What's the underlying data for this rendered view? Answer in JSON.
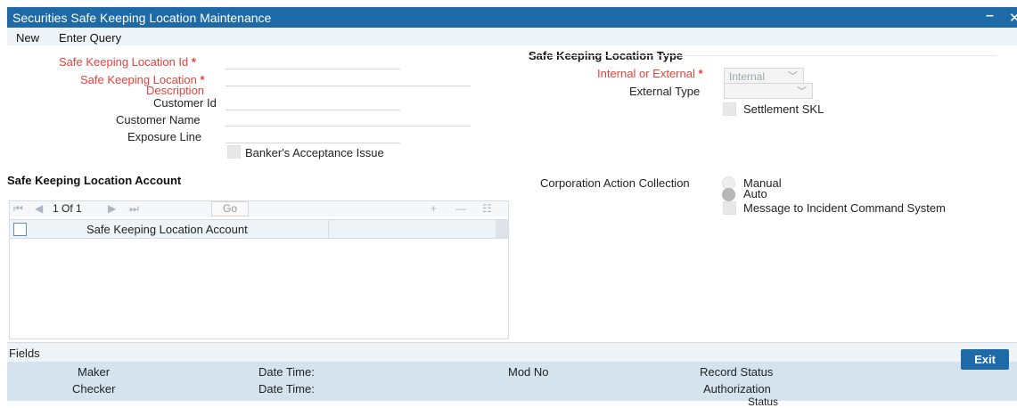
{
  "window": {
    "title": "Securities Safe Keeping Location Maintenance",
    "minimize_glyph": "–",
    "close_glyph": "✕"
  },
  "menu": {
    "new": "New",
    "enter_query": "Enter Query"
  },
  "form": {
    "location_id_label": "Safe Keeping Location Id",
    "description_label_1": "Safe Keeping Location",
    "description_label_2": "Description",
    "customer_id_label": "Customer Id",
    "customer_name_label": "Customer Name",
    "exposure_line_label": "Exposure Line",
    "bankers_acceptance_label": "Banker's Acceptance Issue",
    "required_marker": "*"
  },
  "type_section": {
    "title": "Safe Keeping Location Type",
    "internal_external_label": "Internal or External",
    "internal_external_value": "Internal",
    "external_type_label": "External Type",
    "external_type_value": "",
    "settlement_skl_label": "Settlement SKL"
  },
  "account_section": {
    "title": "Safe Keeping Location Account",
    "page_text": "1 Of 1",
    "go_label": "Go",
    "column_header": "Safe Keeping Location Account"
  },
  "corporation": {
    "label": "Corporation Action Collection",
    "manual": "Manual",
    "auto": "Auto",
    "selected": "Auto",
    "incident_label": "Message to Incident Command System"
  },
  "footer": {
    "fields_label": "Fields",
    "maker": "Maker",
    "checker": "Checker",
    "date_time_1": "Date Time:",
    "date_time_2": "Date Time:",
    "mod_no": "Mod No",
    "record_status": "Record Status",
    "authorization": "Authorization",
    "status_cut": "Status",
    "exit": "Exit"
  },
  "colors": {
    "titlebar": "#1e6aa6",
    "required": "#e8413a",
    "footer": "#d5e3ef"
  }
}
